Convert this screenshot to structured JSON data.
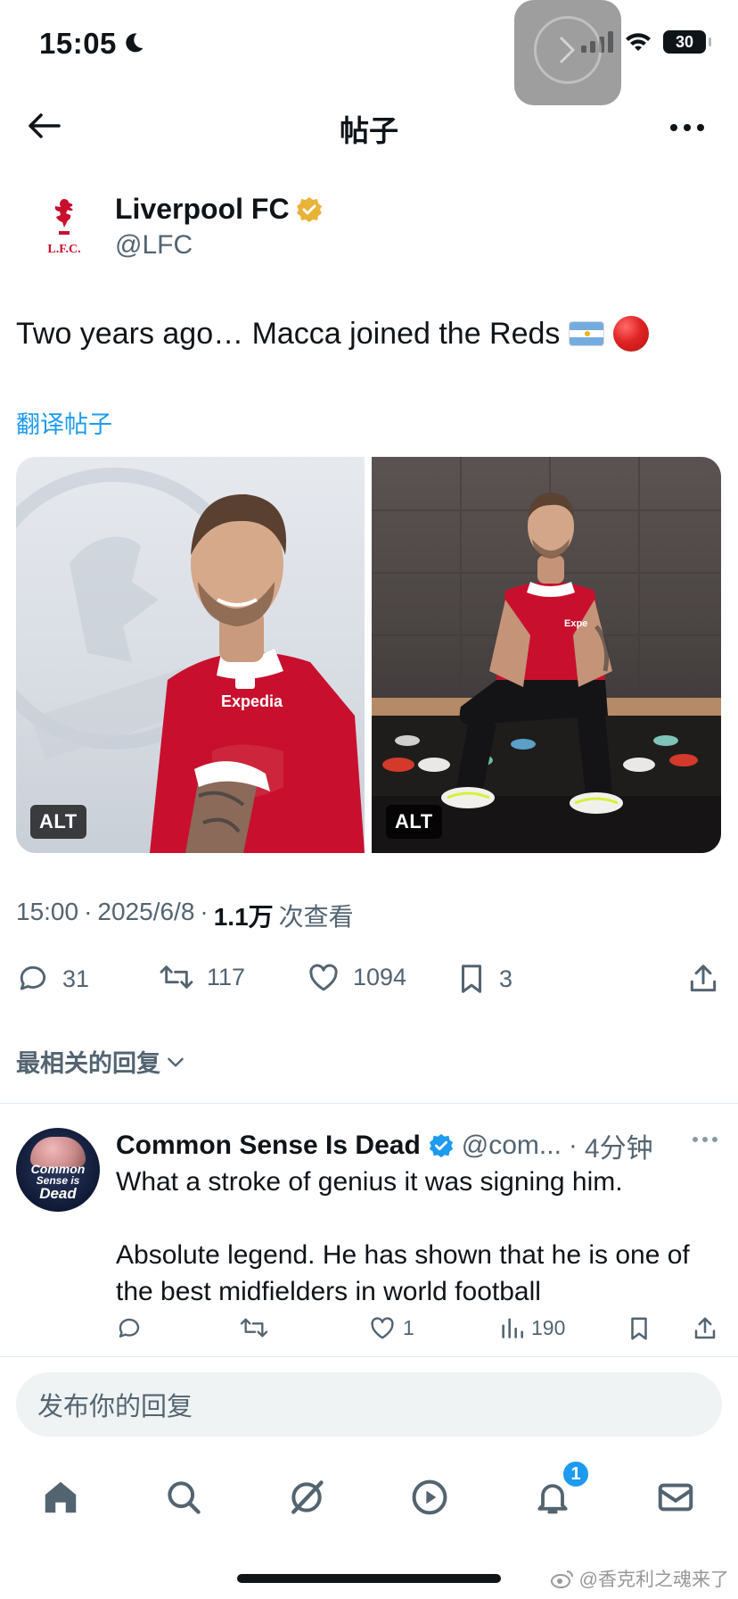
{
  "status_bar": {
    "time": "15:05",
    "battery": "30",
    "icons": [
      "moon-icon",
      "signal-icon",
      "wifi-icon",
      "battery-icon"
    ]
  },
  "nav": {
    "title": "帖子",
    "back_icon": "arrow-left-icon",
    "more_icon": "more-horizontal-icon"
  },
  "post": {
    "author_name": "Liverpool FC",
    "author_handle": "@LFC",
    "verified": "gold",
    "text": "Two years ago… Macca joined the Reds",
    "translate_label": "翻译帖子",
    "media": [
      {
        "alt_label": "ALT",
        "description": "player smiling in red Expedia kit"
      },
      {
        "alt_label": "ALT",
        "description": "player seated on bench in dressing room"
      }
    ],
    "meta": {
      "time": "15:00",
      "date": "2025/6/8",
      "views_value": "1.1万",
      "views_label": "次查看",
      "sep": "·"
    },
    "stats": {
      "replies": "31",
      "reposts": "117",
      "likes": "1094",
      "bookmarks": "3"
    }
  },
  "sort_label": "最相关的回复",
  "reply": {
    "author_name": "Common Sense Is Dead",
    "author_handle": "@com...",
    "sep": "·",
    "time": "4分钟",
    "avatar_text": [
      "Common",
      "Sense is",
      "Dead"
    ],
    "text_1": "What a stroke of genius it was signing him.",
    "text_2": "Absolute legend. He has shown that he is one of the best midfielders in world football",
    "stats": {
      "likes": "1",
      "views": "190"
    }
  },
  "compose": {
    "placeholder": "发布你的回复"
  },
  "tabbar": {
    "items": [
      "home-icon",
      "search-icon",
      "grok-icon",
      "video-icon",
      "notifications-icon",
      "messages-icon"
    ],
    "notification_count": "1"
  },
  "watermark": "@香克利之魂来了",
  "colors": {
    "accent": "#1d9bf0",
    "text": "#0f1419",
    "secondary": "#536471",
    "lfc_red": "#c8102e",
    "gold": "#e8b339"
  }
}
